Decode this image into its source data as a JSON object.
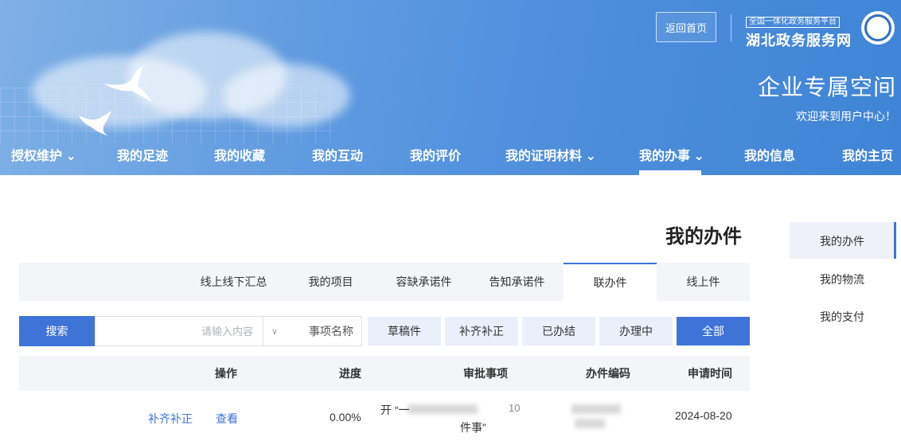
{
  "header": {
    "home_button": "返回首页",
    "logo_small": "全国一体化政务服务平台",
    "logo_big": "湖北政务服务网",
    "space_title": "企业专属空间",
    "welcome": "欢迎来到用户中心！"
  },
  "nav": {
    "items": [
      {
        "label": "我的主页"
      },
      {
        "label": "我的信息"
      },
      {
        "label": "我的办事 ⌄"
      },
      {
        "label": "我的证明材料 ⌄"
      },
      {
        "label": "我的评价"
      },
      {
        "label": "我的互动"
      },
      {
        "label": "我的收藏"
      },
      {
        "label": "我的足迹"
      },
      {
        "label": "授权维护 ⌄"
      }
    ]
  },
  "sidebar": {
    "items": [
      {
        "label": "我的办件"
      },
      {
        "label": "我的物流"
      },
      {
        "label": "我的支付"
      }
    ]
  },
  "main": {
    "title": "我的办件",
    "tabs": [
      {
        "label": "线上件"
      },
      {
        "label": "联办件"
      },
      {
        "label": "告知承诺件"
      },
      {
        "label": "容缺承诺件"
      },
      {
        "label": "我的项目"
      },
      {
        "label": "线上线下汇总"
      }
    ],
    "filters": [
      {
        "label": "全部"
      },
      {
        "label": "办理中"
      },
      {
        "label": "已办结"
      },
      {
        "label": "补齐补正"
      },
      {
        "label": "草稿件"
      }
    ],
    "search": {
      "select_value": "事项名称",
      "placeholder": "请输入内容",
      "button": "搜索"
    },
    "table": {
      "headers": [
        "申请时间",
        "办件编码",
        "审批事项",
        "进度",
        "操作"
      ],
      "rows": [
        {
          "date": "2024-08-20",
          "code_fragment": "10",
          "item_line1": "开 “一",
          "item_line2": "件事”",
          "progress": "0.00%",
          "action_view": "查看",
          "action_fix": "补齐补正"
        }
      ]
    }
  }
}
